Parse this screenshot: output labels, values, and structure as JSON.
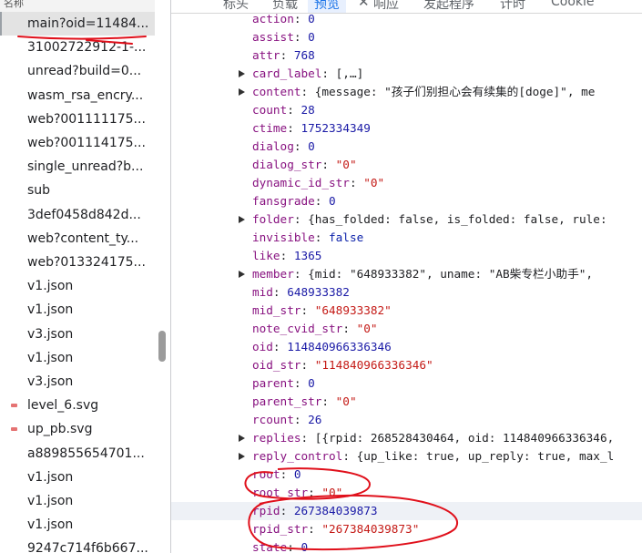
{
  "network": {
    "left_header": "名称",
    "requests": [
      {
        "name": "main?oid=11484...",
        "selected": true
      },
      {
        "name": "31002722912-1-..."
      },
      {
        "name": "unread?build=0..."
      },
      {
        "name": "wasm_rsa_encry..."
      },
      {
        "name": "web?001111175..."
      },
      {
        "name": "web?001114175..."
      },
      {
        "name": "single_unread?b..."
      },
      {
        "name": "sub"
      },
      {
        "name": "3def0458d842d..."
      },
      {
        "name": "web?content_ty..."
      },
      {
        "name": "web?013324175..."
      },
      {
        "name": "v1.json"
      },
      {
        "name": "v1.json"
      },
      {
        "name": "v3.json"
      },
      {
        "name": "v1.json"
      },
      {
        "name": "v3.json"
      },
      {
        "name": "level_6.svg",
        "icon": "svg-file-icon"
      },
      {
        "name": "up_pb.svg",
        "icon": "svg-file-icon"
      },
      {
        "name": "a889855654701..."
      },
      {
        "name": "v1.json"
      },
      {
        "name": "v1.json"
      },
      {
        "name": "v1.json"
      },
      {
        "name": "9247c714f6b667..."
      }
    ]
  },
  "tabs": {
    "close": "✕",
    "items": [
      {
        "label": "标头"
      },
      {
        "label": "负载"
      },
      {
        "label": "预览",
        "active": true
      },
      {
        "label": "响应"
      },
      {
        "label": "发起程序"
      },
      {
        "label": "计时"
      },
      {
        "label": "Cookie"
      }
    ]
  },
  "preview": {
    "lines": [
      {
        "key": "action",
        "value": "0",
        "vtype": "num"
      },
      {
        "key": "assist",
        "value": "0",
        "vtype": "num"
      },
      {
        "key": "attr",
        "value": "768",
        "vtype": "num"
      },
      {
        "key": "card_label",
        "value": "[,…]",
        "vtype": "obj",
        "expandable": true
      },
      {
        "key": "content",
        "value": "{message: \"孩子们别担心会有续集的[doge]\", me",
        "vtype": "obj",
        "expandable": true
      },
      {
        "key": "count",
        "value": "28",
        "vtype": "num"
      },
      {
        "key": "ctime",
        "value": "1752334349",
        "vtype": "num"
      },
      {
        "key": "dialog",
        "value": "0",
        "vtype": "num"
      },
      {
        "key": "dialog_str",
        "value": "\"0\"",
        "vtype": "str"
      },
      {
        "key": "dynamic_id_str",
        "value": "\"0\"",
        "vtype": "str"
      },
      {
        "key": "fansgrade",
        "value": "0",
        "vtype": "num"
      },
      {
        "key": "folder",
        "value": "{has_folded: false, is_folded: false, rule:",
        "vtype": "obj",
        "expandable": true
      },
      {
        "key": "invisible",
        "value": "false",
        "vtype": "bool"
      },
      {
        "key": "like",
        "value": "1365",
        "vtype": "num"
      },
      {
        "key": "member",
        "value": "{mid: \"648933382\", uname: \"AB柴专栏小助手\",",
        "vtype": "obj",
        "expandable": true
      },
      {
        "key": "mid",
        "value": "648933382",
        "vtype": "num"
      },
      {
        "key": "mid_str",
        "value": "\"648933382\"",
        "vtype": "str"
      },
      {
        "key": "note_cvid_str",
        "value": "\"0\"",
        "vtype": "str"
      },
      {
        "key": "oid",
        "value": "114840966336346",
        "vtype": "num"
      },
      {
        "key": "oid_str",
        "value": "\"114840966336346\"",
        "vtype": "str"
      },
      {
        "key": "parent",
        "value": "0",
        "vtype": "num"
      },
      {
        "key": "parent_str",
        "value": "\"0\"",
        "vtype": "str"
      },
      {
        "key": "rcount",
        "value": "26",
        "vtype": "num"
      },
      {
        "key": "replies",
        "value": "[{rpid: 268528430464, oid: 114840966336346,",
        "vtype": "obj",
        "expandable": true
      },
      {
        "key": "reply_control",
        "value": "{up_like: true, up_reply: true, max_l",
        "vtype": "obj",
        "expandable": true
      },
      {
        "key": "root",
        "value": "0",
        "vtype": "num"
      },
      {
        "key": "root_str",
        "value": "\"0\"",
        "vtype": "str"
      },
      {
        "key": "rpid",
        "value": "267384039873",
        "vtype": "num",
        "highlight": true
      },
      {
        "key": "rpid_str",
        "value": "\"267384039873\"",
        "vtype": "str"
      },
      {
        "key": "state",
        "value": "0",
        "vtype": "num"
      }
    ]
  },
  "colors": {
    "annotation": "#e0101b",
    "key": "#881280",
    "number": "#1a1aa6",
    "string": "#c41a16"
  }
}
